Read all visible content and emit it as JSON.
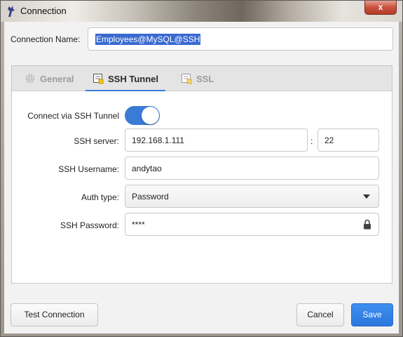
{
  "window": {
    "title": "Connection",
    "close_glyph": "x"
  },
  "connection": {
    "label": "Connection Name:",
    "value": "Employees@MySQL@SSH"
  },
  "tabs": [
    {
      "label": "General",
      "icon": "gear-icon",
      "active": false
    },
    {
      "label": "SSH Tunnel",
      "icon": "note-icon",
      "active": true
    },
    {
      "label": "SSL",
      "icon": "note-icon",
      "active": false
    }
  ],
  "ssh": {
    "connect_label": "Connect via SSH Tunnel",
    "connect_enabled": true,
    "server_label": "SSH server:",
    "server_value": "192.168.1.111",
    "port_separator": ":",
    "port_value": "22",
    "username_label": "SSH Username:",
    "username_value": "andytao",
    "auth_label": "Auth type:",
    "auth_value": "Password",
    "password_label": "SSH Password:",
    "password_value": "****"
  },
  "buttons": {
    "test": "Test Connection",
    "cancel": "Cancel",
    "save": "Save"
  },
  "colors": {
    "accent": "#3a7bd5",
    "selection": "#3a6ad0"
  }
}
